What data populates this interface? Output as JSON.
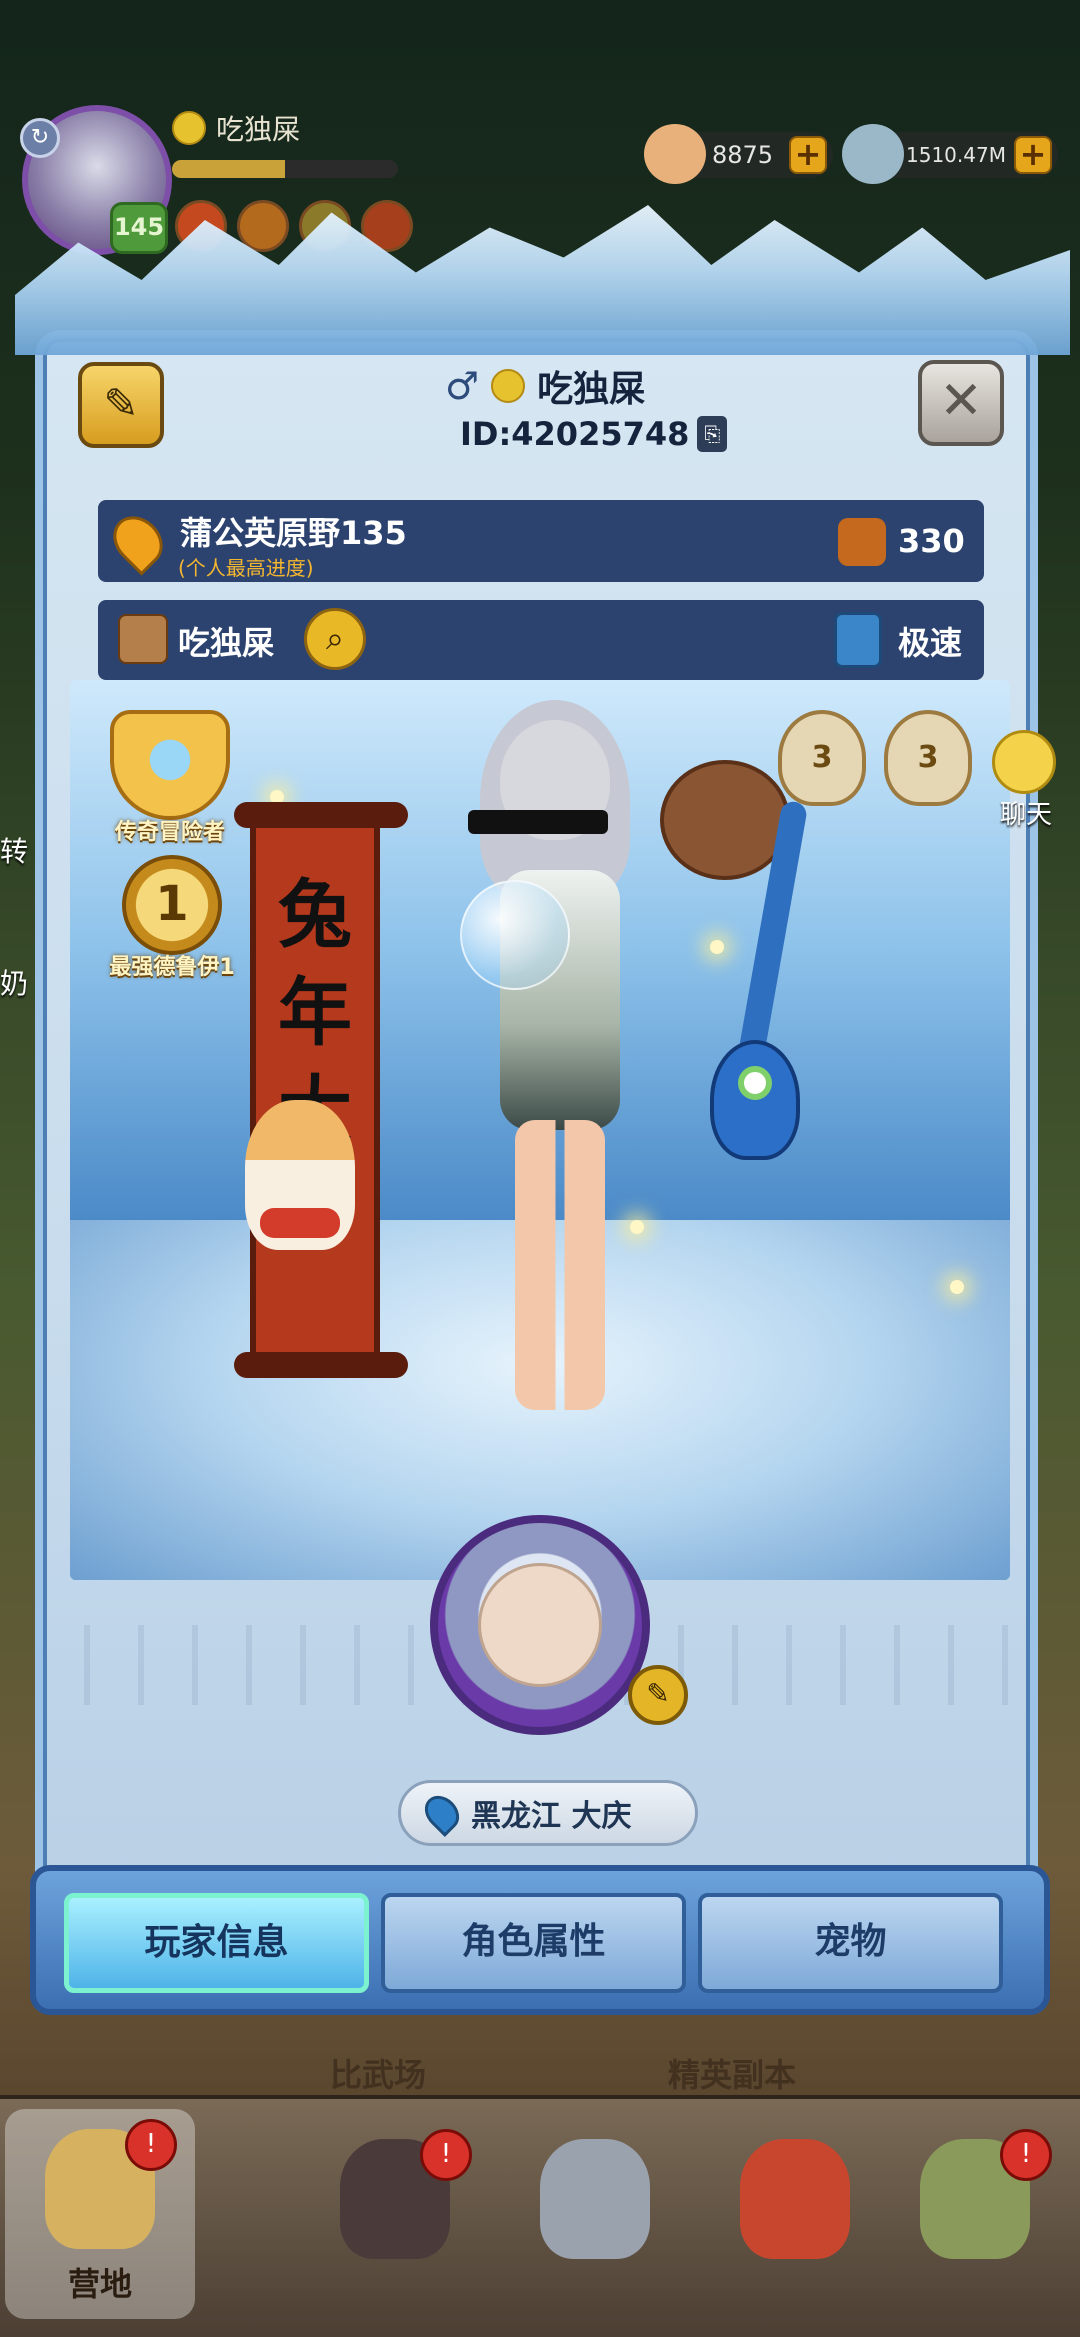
{
  "hud": {
    "player_name": "吃独屎",
    "level": "145",
    "xp_fraction": 0.5,
    "currency1": "8875",
    "currency2": "1510.47M",
    "plus": "+"
  },
  "side_menu": [
    "转",
    "奶"
  ],
  "profile": {
    "name": "吃独屎",
    "id_text": "ID:42025748",
    "region_name": "蒲公英原野135",
    "region_sub": "(个人最高进度)",
    "power": "330",
    "guild_name": "吃独屎",
    "speed": "极速",
    "badge_legend": "传奇冒险者",
    "badge_rank": "最强德鲁伊1",
    "rank_number": "1",
    "emblem1": "3",
    "emblem2": "3",
    "scroll_text": "兔年大吉",
    "location": "黑龙江 大庆"
  },
  "chat": {
    "label": "聊天"
  },
  "tabs": [
    {
      "label": "玩家信息",
      "active": true
    },
    {
      "label": "角色属性",
      "active": false
    },
    {
      "label": "宠物",
      "active": false
    }
  ],
  "bottom": {
    "arena_label": "比武场",
    "elite_label": "精英副本",
    "nav": [
      {
        "label": "营地"
      },
      {
        "label": ""
      },
      {
        "label": ""
      },
      {
        "label": ""
      },
      {
        "label": ""
      }
    ]
  },
  "colors": {
    "active_tab": "#4fb3e8",
    "gold": "#e6a61c",
    "panel": "#d6e6f2"
  }
}
